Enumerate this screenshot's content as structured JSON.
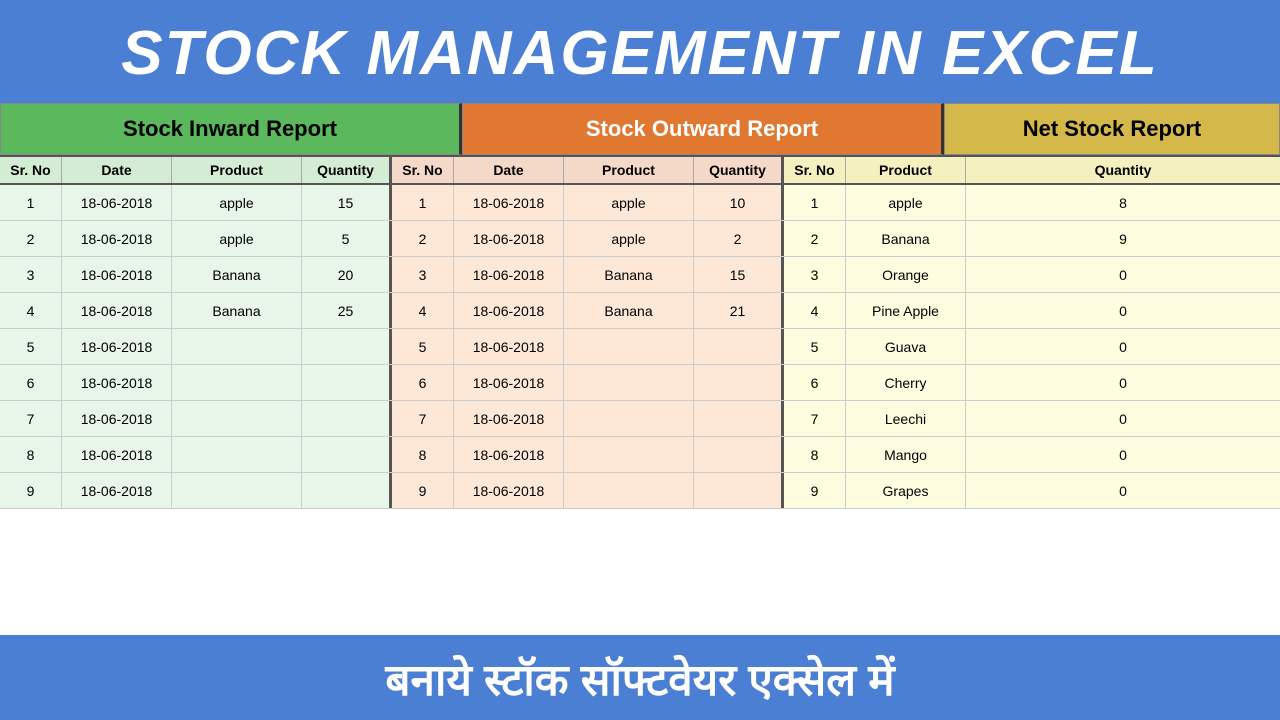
{
  "header": {
    "title": "STOCK MANAGEMENT IN EXCEL"
  },
  "sections": {
    "inward": {
      "label": "Stock Inward Report",
      "color": "#5cb85c"
    },
    "outward": {
      "label": "Stock Outward Report",
      "color": "#e07832"
    },
    "net": {
      "label": "Net Stock Report",
      "color": "#d4b84a"
    }
  },
  "columns": {
    "inward": [
      "Sr. No",
      "Date",
      "Product",
      "Quantity"
    ],
    "outward": [
      "Sr. No",
      "Date",
      "Product",
      "Quantity"
    ],
    "net": [
      "Sr. No",
      "Product",
      "Quantity"
    ]
  },
  "inward_rows": [
    {
      "srno": "1",
      "date": "18-06-2018",
      "product": "apple",
      "qty": "15"
    },
    {
      "srno": "2",
      "date": "18-06-2018",
      "product": "apple",
      "qty": "5"
    },
    {
      "srno": "3",
      "date": "18-06-2018",
      "product": "Banana",
      "qty": "20"
    },
    {
      "srno": "4",
      "date": "18-06-2018",
      "product": "Banana",
      "qty": "25"
    },
    {
      "srno": "5",
      "date": "18-06-2018",
      "product": "",
      "qty": ""
    },
    {
      "srno": "6",
      "date": "18-06-2018",
      "product": "",
      "qty": ""
    },
    {
      "srno": "7",
      "date": "18-06-2018",
      "product": "",
      "qty": ""
    },
    {
      "srno": "8",
      "date": "18-06-2018",
      "product": "",
      "qty": ""
    },
    {
      "srno": "9",
      "date": "18-06-2018",
      "product": "",
      "qty": ""
    }
  ],
  "outward_rows": [
    {
      "srno": "1",
      "date": "18-06-2018",
      "product": "apple",
      "qty": "10"
    },
    {
      "srno": "2",
      "date": "18-06-2018",
      "product": "apple",
      "qty": "2"
    },
    {
      "srno": "3",
      "date": "18-06-2018",
      "product": "Banana",
      "qty": "15"
    },
    {
      "srno": "4",
      "date": "18-06-2018",
      "product": "Banana",
      "qty": "21"
    },
    {
      "srno": "5",
      "date": "18-06-2018",
      "product": "",
      "qty": ""
    },
    {
      "srno": "6",
      "date": "18-06-2018",
      "product": "",
      "qty": ""
    },
    {
      "srno": "7",
      "date": "18-06-2018",
      "product": "",
      "qty": ""
    },
    {
      "srno": "8",
      "date": "18-06-2018",
      "product": "",
      "qty": ""
    },
    {
      "srno": "9",
      "date": "18-06-2018",
      "product": "",
      "qty": ""
    }
  ],
  "net_rows": [
    {
      "srno": "1",
      "product": "apple",
      "qty": "8"
    },
    {
      "srno": "2",
      "product": "Banana",
      "qty": "9"
    },
    {
      "srno": "3",
      "product": "Orange",
      "qty": "0"
    },
    {
      "srno": "4",
      "product": "Pine Apple",
      "qty": "0"
    },
    {
      "srno": "5",
      "product": "Guava",
      "qty": "0"
    },
    {
      "srno": "6",
      "product": "Cherry",
      "qty": "0"
    },
    {
      "srno": "7",
      "product": "Leechi",
      "qty": "0"
    },
    {
      "srno": "8",
      "product": "Mango",
      "qty": "0"
    },
    {
      "srno": "9",
      "product": "Grapes",
      "qty": "0"
    }
  ],
  "footer": {
    "text": "बनाये स्टॉक सॉफ्टवेयर एक्सेल में"
  }
}
